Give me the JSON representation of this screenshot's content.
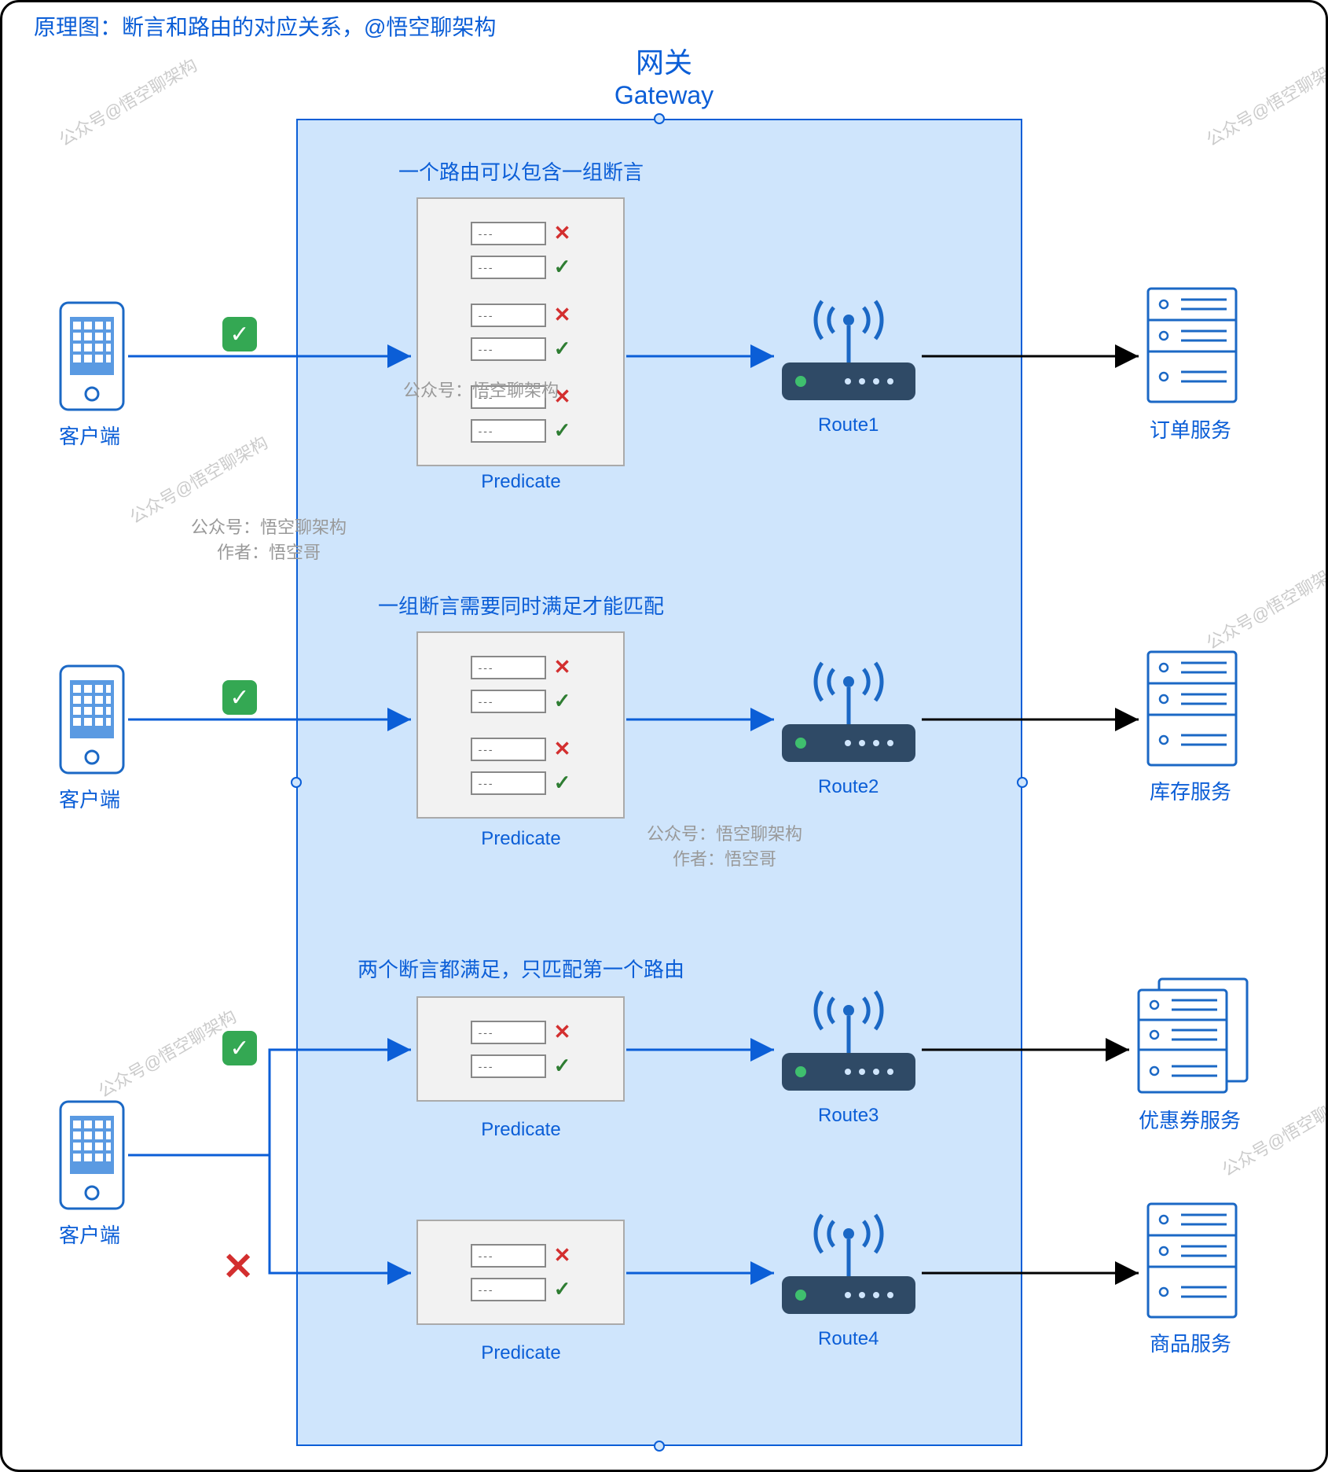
{
  "header": "原理图：断言和路由的对应关系，@悟空聊架构",
  "gateway": {
    "title_cn": "网关",
    "title_en": "Gateway"
  },
  "sections": {
    "s1": "一个路由可以包含一组断言",
    "s2": "一组断言需要同时满足才能匹配",
    "s3": "两个断言都满足，只匹配第一个路由"
  },
  "predicate_label": "Predicate",
  "clients": {
    "c1": "客户端",
    "c2": "客户端",
    "c3": "客户端"
  },
  "routes": {
    "r1": "Route1",
    "r2": "Route2",
    "r3": "Route3",
    "r4": "Route4"
  },
  "services": {
    "s1": "订单服务",
    "s2": "库存服务",
    "s3": "优惠券服务",
    "s4": "商品服务"
  },
  "dash": "---",
  "watermarks": {
    "w1": "公众号：悟空聊架构",
    "w2_line1": "公众号：悟空聊架构",
    "w2_line2": "作者：悟空哥",
    "w3_line1": "公众号：悟空聊架构",
    "w3_line2": "作者：悟空哥",
    "diag": "公众号@悟空聊架构"
  }
}
